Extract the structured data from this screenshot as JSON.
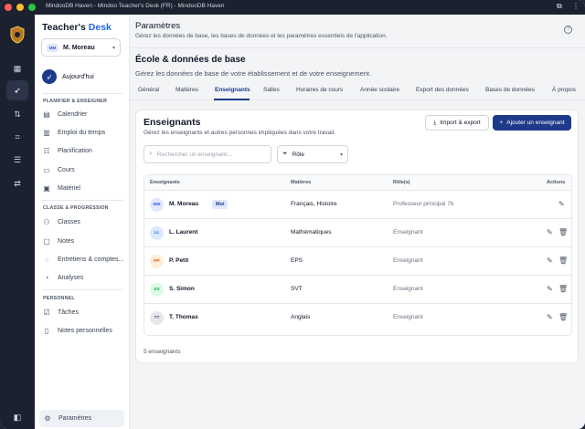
{
  "window": {
    "title": "MindooDB Haven - Mindoo Teacher's Desk (FR) - MindooDB Haven",
    "colors": {
      "close": "#ff5f57",
      "minimize": "#febc2e",
      "maximize": "#28c840"
    }
  },
  "rail": {
    "icons": [
      "dashboard-icon",
      "rocket-icon",
      "transfer-icon",
      "scan-icon",
      "database-icon",
      "sliders-icon",
      "panel-icon"
    ]
  },
  "sidebar": {
    "brand_main": "Teacher's",
    "brand_accent": "Desk",
    "user": {
      "initials": "MM",
      "name": "M. Moreau"
    },
    "today_label": "Aujourd'hui",
    "section_plan": "PLANIFIER & ENSEIGNER",
    "plan_items": [
      {
        "label": "Calendrier",
        "icon": "calendar-icon"
      },
      {
        "label": "Emploi du temps",
        "icon": "schedule-icon"
      },
      {
        "label": "Planification",
        "icon": "planning-icon"
      },
      {
        "label": "Cours",
        "icon": "course-icon"
      },
      {
        "label": "Matériel",
        "icon": "folder-icon"
      }
    ],
    "section_class": "CLASSE & PROGRESSION",
    "class_items": [
      {
        "label": "Classes",
        "icon": "classes-icon"
      },
      {
        "label": "Notes",
        "icon": "notes-icon"
      },
      {
        "label": "Entretiens & comptes...",
        "icon": "chat-icon"
      },
      {
        "label": "Analyses",
        "icon": "chart-icon"
      }
    ],
    "section_personal": "PERSONNEL",
    "personal_items": [
      {
        "label": "Tâches",
        "icon": "tasks-icon"
      },
      {
        "label": "Notes personnelles",
        "icon": "personal-notes-icon"
      }
    ],
    "settings_label": "Paramètres"
  },
  "header": {
    "title": "Paramètres",
    "subtitle": "Gérez les données de base, les bases de données et les paramètres essentiels de l'application."
  },
  "section": {
    "title": "École & données de base",
    "subtitle": "Gérez les données de base de votre établissement et de votre enseignement."
  },
  "tabs": [
    "Général",
    "Matières",
    "Enseignants",
    "Salles",
    "Horaires de cours",
    "Année scolaire",
    "Export des données",
    "Bases de données",
    "À propos"
  ],
  "active_tab": "Enseignants",
  "card": {
    "title": "Enseignants",
    "subtitle": "Gérez les enseignants et autres personnes impliquées dans votre travail.",
    "export_label": "Import & export",
    "add_label": "Ajouter un enseignant",
    "search_placeholder": "Rechercher un enseignant...",
    "role_filter": "Rôle",
    "columns": {
      "name": "Enseignants",
      "subjects": "Matières",
      "role": "Rôle(s)",
      "actions": "Actions"
    },
    "count_text": "5 enseignants",
    "badge_me": "Moi",
    "rows": [
      {
        "initials": "MM",
        "name": "M. Moreau",
        "subjects": "Français, Histoire",
        "role": "Professeur principal 7b",
        "me": true,
        "avatar_bg": "#e0e7ff",
        "avatar_fg": "#3b5bdb"
      },
      {
        "initials": "LL",
        "name": "L. Laurent",
        "subjects": "Mathématiques",
        "role": "Enseignant",
        "me": false,
        "avatar_bg": "#dbeafe",
        "avatar_fg": "#2563eb"
      },
      {
        "initials": "PP",
        "name": "P. Petit",
        "subjects": "EPS",
        "role": "Enseignant",
        "me": false,
        "avatar_bg": "#ffedd5",
        "avatar_fg": "#ea580c"
      },
      {
        "initials": "SS",
        "name": "S. Simon",
        "subjects": "SVT",
        "role": "Enseignant",
        "me": false,
        "avatar_bg": "#dcfce7",
        "avatar_fg": "#16a34a"
      },
      {
        "initials": "TT",
        "name": "T. Thomas",
        "subjects": "Anglais",
        "role": "Enseignant",
        "me": false,
        "avatar_bg": "#e5e7eb",
        "avatar_fg": "#4b5563"
      }
    ]
  }
}
